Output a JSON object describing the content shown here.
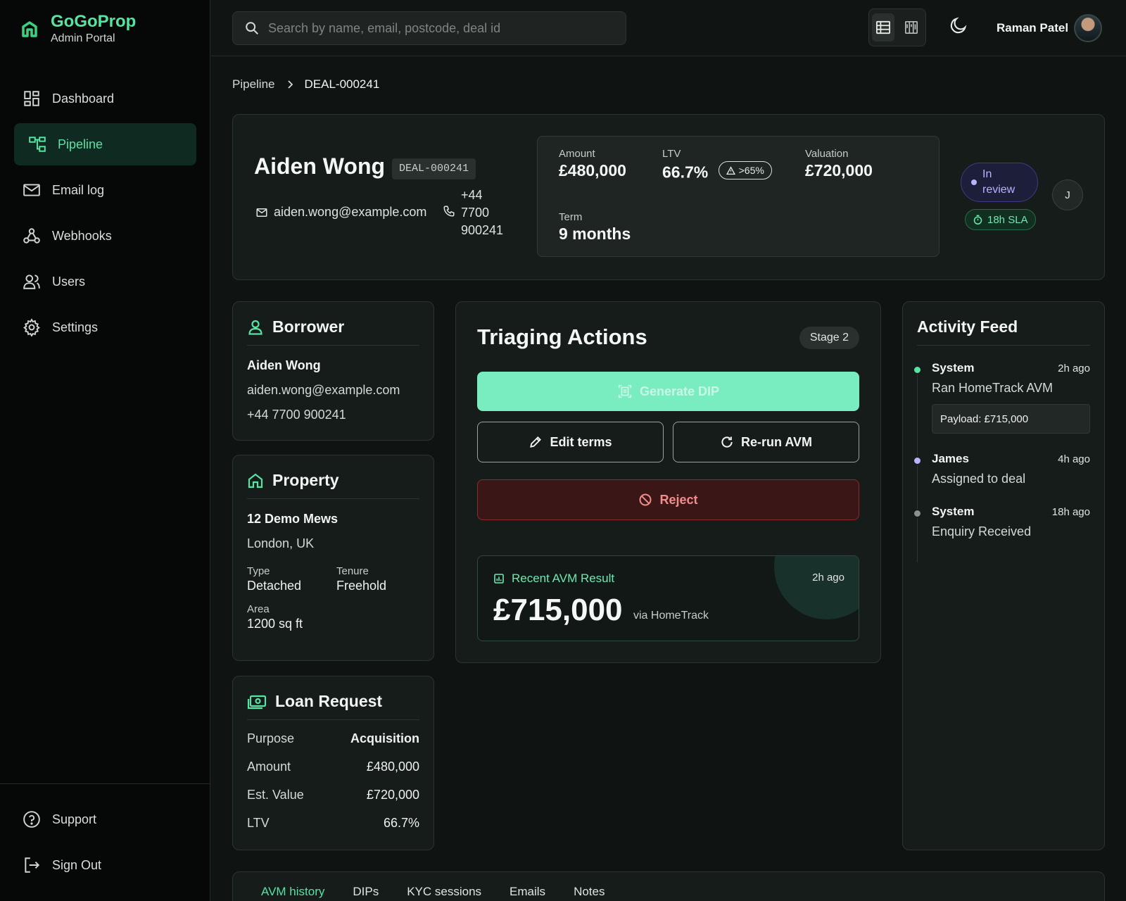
{
  "brand": {
    "name": "GoGoProp",
    "subtitle": "Admin Portal"
  },
  "sidebar": {
    "items": [
      {
        "label": "Dashboard",
        "icon": "dashboard-icon"
      },
      {
        "label": "Pipeline",
        "icon": "pipeline-icon",
        "active": true
      },
      {
        "label": "Email log",
        "icon": "mail-icon"
      },
      {
        "label": "Webhooks",
        "icon": "webhook-icon"
      },
      {
        "label": "Users",
        "icon": "users-icon"
      },
      {
        "label": "Settings",
        "icon": "gear-icon"
      }
    ],
    "bottom": [
      {
        "label": "Support",
        "icon": "help-icon"
      },
      {
        "label": "Sign Out",
        "icon": "sign-out-icon"
      }
    ]
  },
  "topbar": {
    "search_placeholder": "Search by name, email, postcode, deal id",
    "user_name": "Raman Patel"
  },
  "breadcrumb": {
    "parent": "Pipeline",
    "current": "DEAL-000241"
  },
  "deal": {
    "name": "Aiden Wong",
    "id": "DEAL-000241",
    "email": "aiden.wong@example.com",
    "phone": "+44 7700 900241",
    "stats": {
      "amount_label": "Amount",
      "amount": "£480,000",
      "ltv_label": "LTV",
      "ltv": "66.7%",
      "ltv_badge": ">65%",
      "valuation_label": "Valuation",
      "valuation": "£720,000",
      "term_label": "Term",
      "term": "9 months"
    },
    "status": "In review",
    "sla": "18h SLA",
    "assignee_initial": "J"
  },
  "borrower": {
    "title": "Borrower",
    "name": "Aiden Wong",
    "email": "aiden.wong@example.com",
    "phone": "+44 7700 900241"
  },
  "property": {
    "title": "Property",
    "address": "12 Demo Mews",
    "city": "London, UK",
    "type_label": "Type",
    "type": "Detached",
    "tenure_label": "Tenure",
    "tenure": "Freehold",
    "area_label": "Area",
    "area": "1200 sq ft"
  },
  "loan": {
    "title": "Loan Request",
    "rows": [
      {
        "label": "Purpose",
        "value": "Acquisition"
      },
      {
        "label": "Amount",
        "value": "£480,000"
      },
      {
        "label": "Est. Value",
        "value": "£720,000"
      },
      {
        "label": "LTV",
        "value": "66.7%"
      }
    ]
  },
  "triage": {
    "title": "Triaging Actions",
    "stage": "Stage 2",
    "generate_dip": "Generate DIP",
    "edit_terms": "Edit terms",
    "rerun_avm": "Re-run AVM",
    "reject": "Reject",
    "avm": {
      "label": "Recent AVM Result",
      "time": "2h ago",
      "value": "£715,000",
      "source": "via HomeTrack"
    }
  },
  "feed": {
    "title": "Activity Feed",
    "items": [
      {
        "actor": "System",
        "time": "2h ago",
        "message": "Ran HomeTrack AVM",
        "payload": "Payload: £715,000",
        "color": "#57e3a2"
      },
      {
        "actor": "James",
        "time": "4h ago",
        "message": "Assigned to deal",
        "color": "#b7b3ff"
      },
      {
        "actor": "System",
        "time": "18h ago",
        "message": "Enquiry Received",
        "color": "#8a918e"
      }
    ]
  },
  "tabs": [
    "AVM history",
    "DIPs",
    "KYC sessions",
    "Emails",
    "Notes"
  ],
  "colors": {
    "accent": "#57e3a2",
    "danger": "#f08d8d",
    "review": "#b7b3ff"
  }
}
